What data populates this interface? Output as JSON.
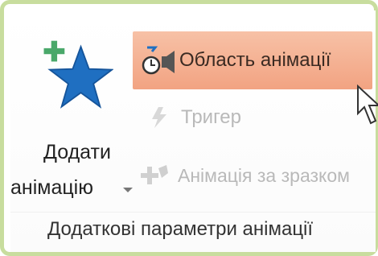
{
  "ribbon": {
    "add_animation": {
      "line1": "Додати",
      "line2": "анімацію",
      "icon": "star-add-icon",
      "dropdown_icon": "dropdown-caret-icon"
    },
    "animation_pane": {
      "label": "Область анімації",
      "icon": "animation-pane-icon",
      "state": "hover"
    },
    "trigger": {
      "label": "Тригер",
      "icon": "lightning-icon",
      "enabled": false
    },
    "animation_painter": {
      "label": "Анімація за зразком",
      "icon": "brush-icon",
      "enabled": false
    },
    "group_label": "Додаткові параметри анімації"
  },
  "colors": {
    "hover_bg": "#f4b08f",
    "star": "#1f6fc1",
    "plus": "#4aa86a",
    "disabled_text": "#b9b9b9",
    "frame": "#c8dd9e"
  }
}
